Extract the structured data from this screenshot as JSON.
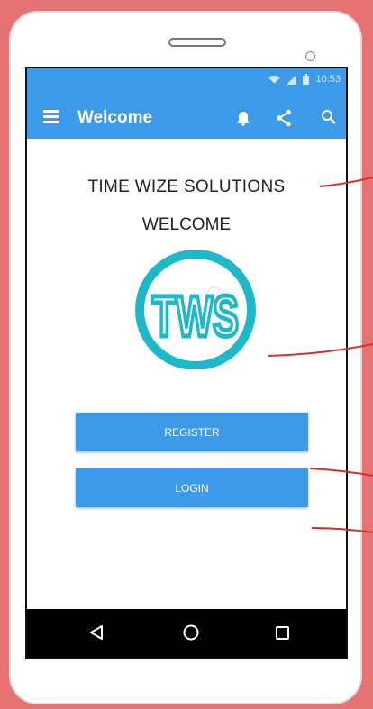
{
  "statusbar": {
    "time": "10:53"
  },
  "appbar": {
    "title": "Welcome"
  },
  "content": {
    "company_name": "TIME WIZE SOLUTIONS",
    "welcome_text": "WELCOME",
    "logo_text": "TWS",
    "register_label": "REGISTER",
    "login_label": "LOGIN"
  },
  "colors": {
    "accent": "#3d9ae8",
    "logo": "#1fb8c9",
    "frame": "#e57373"
  },
  "icons": {
    "appbar": [
      "menu-icon",
      "bell-icon",
      "share-icon",
      "search-icon"
    ],
    "statusbar": [
      "wifi-icon",
      "signal-icon",
      "battery-icon"
    ],
    "navbar": [
      "back-icon",
      "home-icon",
      "recent-apps-icon"
    ]
  }
}
